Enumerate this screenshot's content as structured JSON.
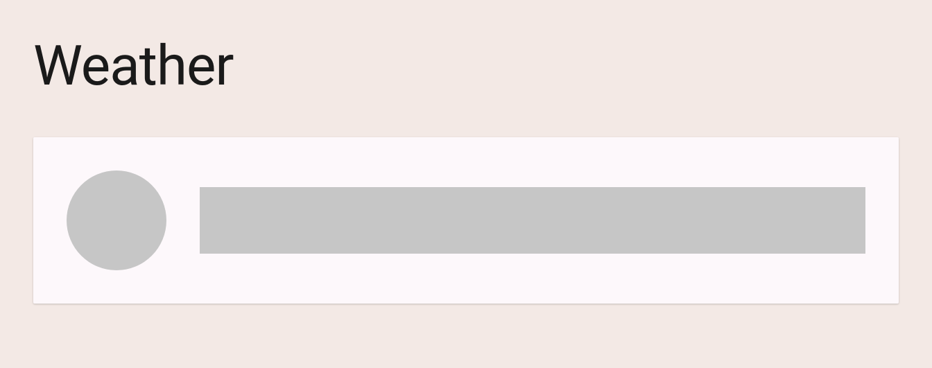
{
  "header": {
    "title": "Weather"
  }
}
